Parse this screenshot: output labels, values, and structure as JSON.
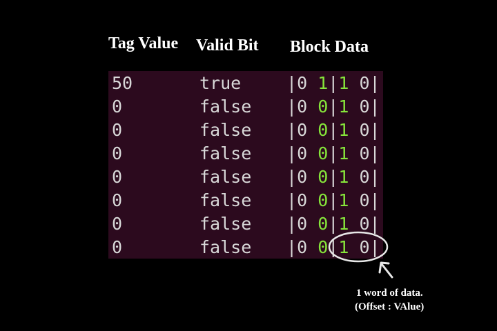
{
  "headers": {
    "tag": "Tag Value",
    "valid": "Valid Bit",
    "block": "Block Data"
  },
  "rows": [
    {
      "tag": "50",
      "valid": "true",
      "block": {
        "w0_offset": "0",
        "w0_value": "1",
        "w1_offset": "1",
        "w1_value": "0"
      }
    },
    {
      "tag": "0",
      "valid": "false",
      "block": {
        "w0_offset": "0",
        "w0_value": "0",
        "w1_offset": "1",
        "w1_value": "0"
      }
    },
    {
      "tag": "0",
      "valid": "false",
      "block": {
        "w0_offset": "0",
        "w0_value": "0",
        "w1_offset": "1",
        "w1_value": "0"
      }
    },
    {
      "tag": "0",
      "valid": "false",
      "block": {
        "w0_offset": "0",
        "w0_value": "0",
        "w1_offset": "1",
        "w1_value": "0"
      }
    },
    {
      "tag": "0",
      "valid": "false",
      "block": {
        "w0_offset": "0",
        "w0_value": "0",
        "w1_offset": "1",
        "w1_value": "0"
      }
    },
    {
      "tag": "0",
      "valid": "false",
      "block": {
        "w0_offset": "0",
        "w0_value": "0",
        "w1_offset": "1",
        "w1_value": "0"
      }
    },
    {
      "tag": "0",
      "valid": "false",
      "block": {
        "w0_offset": "0",
        "w0_value": "0",
        "w1_offset": "1",
        "w1_value": "0"
      }
    },
    {
      "tag": "0",
      "valid": "false",
      "block": {
        "w0_offset": "0",
        "w0_value": "0",
        "w1_offset": "1",
        "w1_value": "0"
      }
    }
  ],
  "annotation": {
    "line1": "1 word of data.",
    "line2": "(Offset : VAlue)"
  },
  "colors": {
    "background": "#000000",
    "terminal_bg": "#2c0a1e",
    "terminal_text": "#d8d8d8",
    "offset_digit": "#86e53a",
    "header_text": "#ffffff"
  }
}
